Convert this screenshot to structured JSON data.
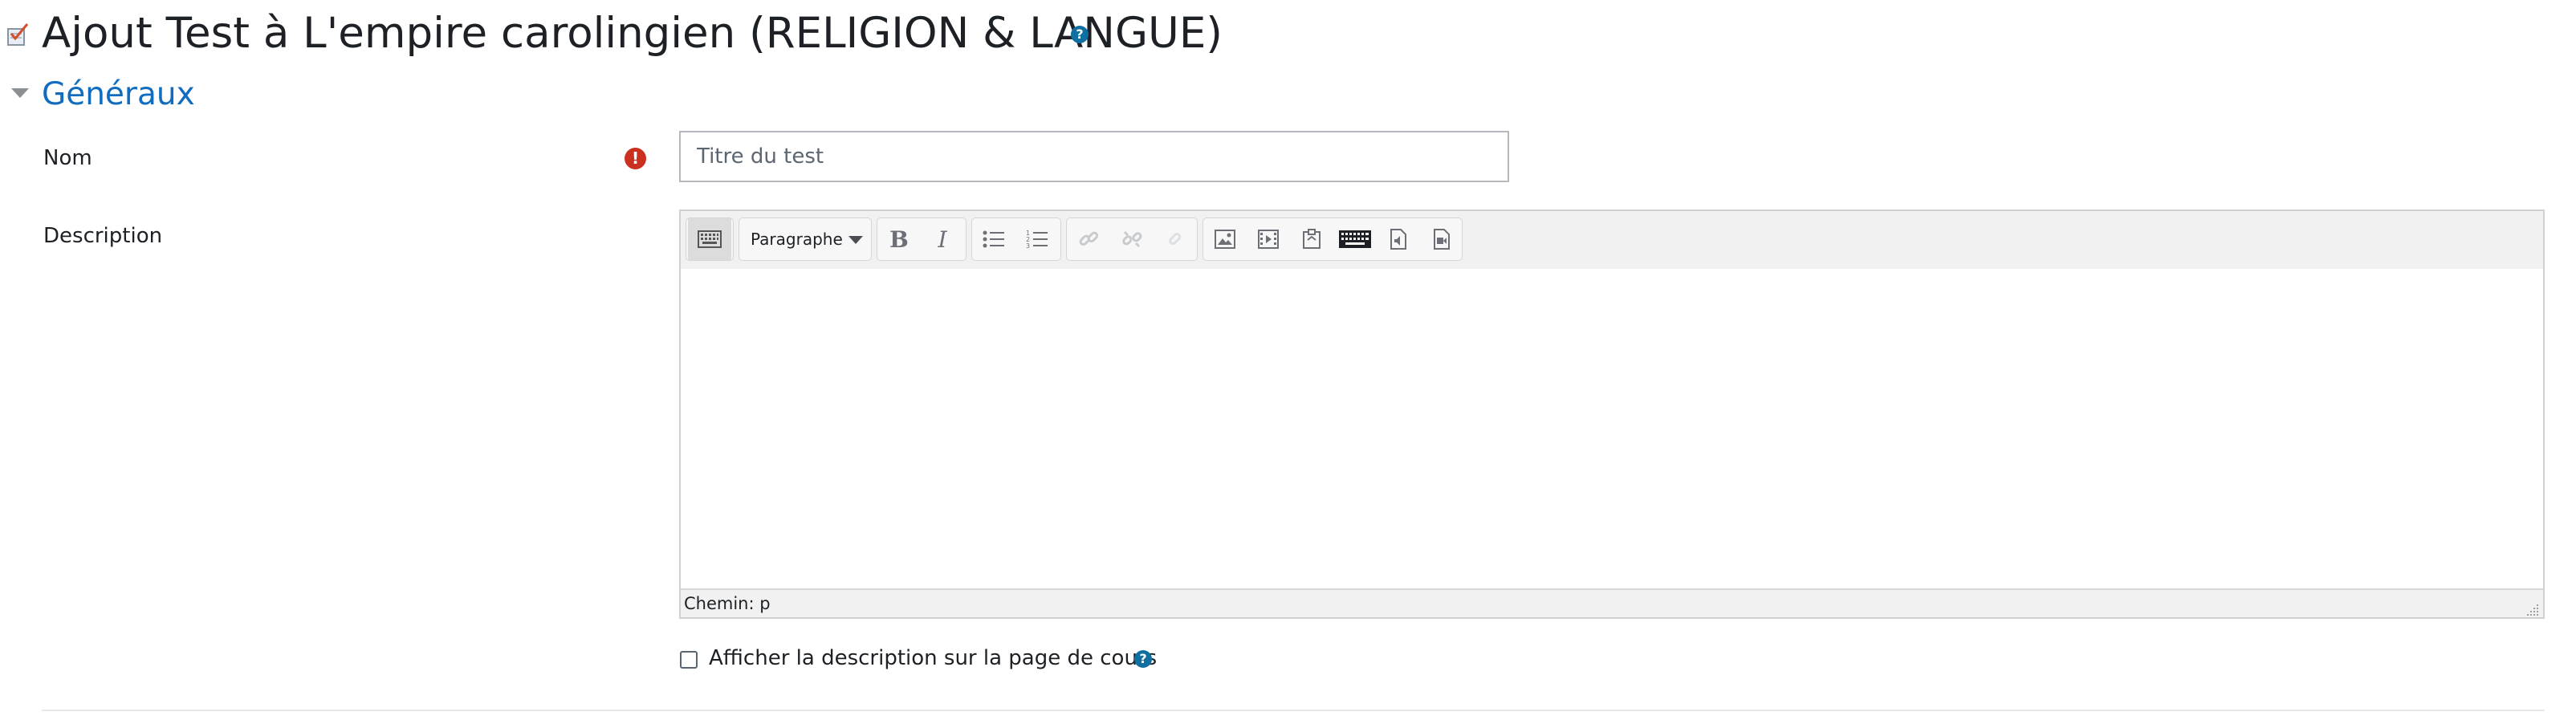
{
  "page": {
    "title": "Ajout Test à L'empire carolingien (RELIGION & LANGUE)",
    "title_icon": "quiz-icon",
    "help_icon": "question-circle-icon"
  },
  "section": {
    "title": "Généraux",
    "collapse_icon": "caret-down-icon"
  },
  "form": {
    "name_label": "Nom",
    "name_required_icon": "exclamation-circle-icon",
    "name_placeholder": "Titre du test",
    "name_value": "",
    "description_label": "Description",
    "editor": {
      "toolbar": {
        "groups": [
          [
            "show-more-buttons-icon"
          ],
          [
            "paragraph-style-select"
          ],
          [
            "bold-icon",
            "italic-icon"
          ],
          [
            "unordered-list-icon",
            "ordered-list-icon"
          ],
          [
            "link-icon",
            "unlink-icon",
            "link-disabled-icon"
          ],
          [
            "image-icon",
            "media-icon",
            "manage-files-icon",
            "keyboard-icon",
            "record-audio-icon",
            "record-video-icon"
          ]
        ],
        "paragraph_label": "Paragraphe"
      },
      "path_label": "Chemin: p",
      "content": ""
    },
    "show_description_label": "Afficher la description sur la page de cours",
    "show_description_checked": false
  },
  "colors": {
    "link_blue": "#0f6cbf",
    "help_blue": "#0f6fa0",
    "required_red": "#ca3120",
    "text": "#1d2125"
  }
}
